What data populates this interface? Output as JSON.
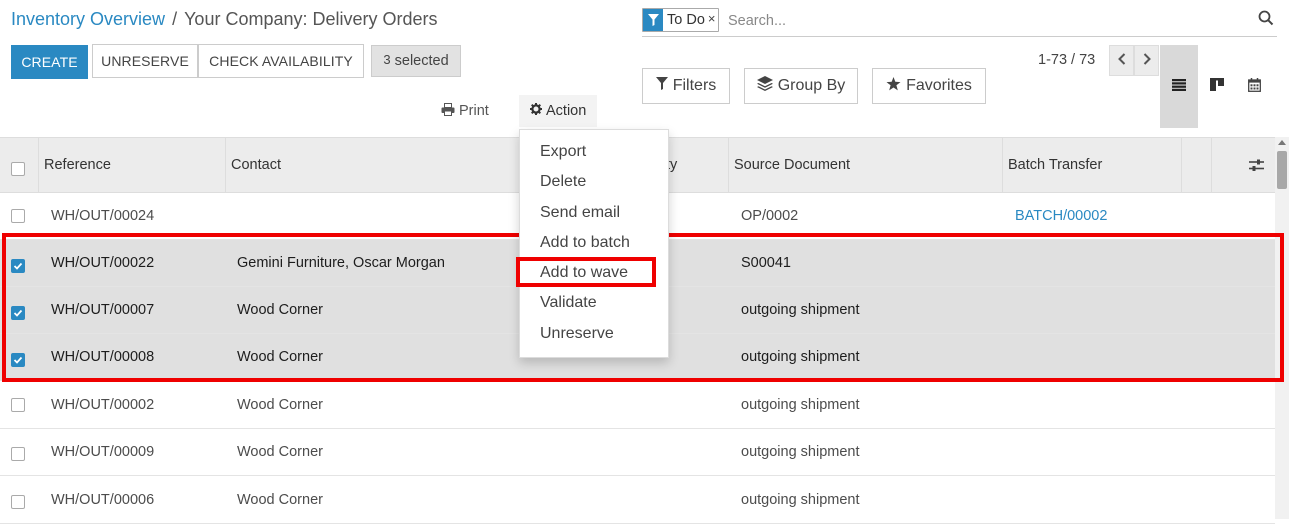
{
  "breadcrumb": {
    "parent": "Inventory Overview",
    "separator": "/",
    "current": "Your Company: Delivery Orders"
  },
  "search": {
    "facet_icon": "filter-icon",
    "facet_label": "To Do",
    "facet_close": "×",
    "placeholder": "Search..."
  },
  "toolbar": {
    "create_label": "CREATE",
    "unreserve_label": "UNRESERVE",
    "check_availability_label": "CHECK AVAILABILITY",
    "selected_count": "3",
    "selected_text": "selected",
    "print_label": "Print",
    "action_label": "Action"
  },
  "filters": {
    "filters_label": "Filters",
    "group_by_label": "Group By",
    "favorites_label": "Favorites"
  },
  "pager": {
    "range": "1-73 / 73"
  },
  "views": [
    "list-view-icon",
    "kanban-view-icon",
    "calendar-view-icon"
  ],
  "table": {
    "columns": [
      "Reference",
      "Contact",
      "ty",
      "Source Document",
      "Batch Transfer"
    ],
    "rows": [
      {
        "reference": "WH/OUT/00024",
        "contact": "",
        "source": "OP/0002",
        "batch": "BATCH/00002",
        "selected": false
      },
      {
        "reference": "WH/OUT/00022",
        "contact": "Gemini Furniture, Oscar Morgan",
        "source": "S00041",
        "batch": "",
        "selected": true
      },
      {
        "reference": "WH/OUT/00007",
        "contact": "Wood Corner",
        "source": "outgoing shipment",
        "batch": "",
        "selected": true
      },
      {
        "reference": "WH/OUT/00008",
        "contact": "Wood Corner",
        "source": "outgoing shipment",
        "batch": "",
        "selected": true
      },
      {
        "reference": "WH/OUT/00002",
        "contact": "Wood Corner",
        "source": "outgoing shipment",
        "batch": "",
        "selected": false
      },
      {
        "reference": "WH/OUT/00009",
        "contact": "Wood Corner",
        "source": "outgoing shipment",
        "batch": "",
        "selected": false
      },
      {
        "reference": "WH/OUT/00006",
        "contact": "Wood Corner",
        "source": "outgoing shipment",
        "batch": "",
        "selected": false
      }
    ]
  },
  "action_menu": {
    "items": [
      "Export",
      "Delete",
      "Send email",
      "Add to batch",
      "Add to wave",
      "Validate",
      "Unreserve"
    ],
    "highlighted": "Add to wave"
  },
  "colors": {
    "accent": "#2a89c2",
    "highlight": "#ef0000",
    "selected_row": "#e0e0e0"
  }
}
